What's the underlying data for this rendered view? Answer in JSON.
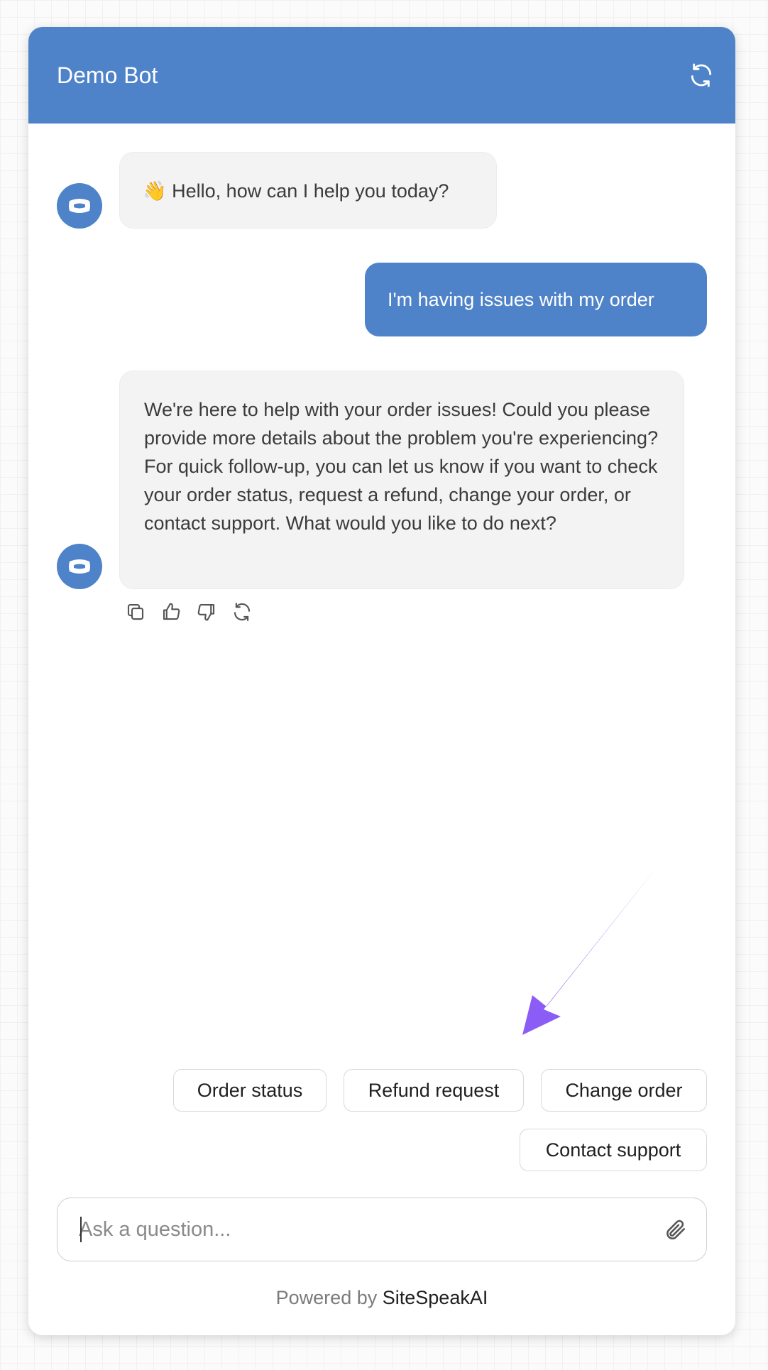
{
  "header": {
    "title": "Demo Bot",
    "refresh_icon": "refresh-icon"
  },
  "messages": [
    {
      "role": "bot",
      "emoji": "👋",
      "text": "Hello, how can I help you today?"
    },
    {
      "role": "user",
      "text": "I'm having issues with my order"
    },
    {
      "role": "bot",
      "text": "We're here to help with your order issues! Could you please provide more details about the problem you're experiencing? For quick follow-up, you can let us know if you want to check your order status, request a refund, change your order, or contact support. What would you like to do next?"
    }
  ],
  "message_actions": [
    "copy-icon",
    "thumbs-up-icon",
    "thumbs-down-icon",
    "regenerate-icon"
  ],
  "suggestions": [
    "Order status",
    "Refund request",
    "Change order",
    "Contact support"
  ],
  "input": {
    "placeholder": "Ask a question...",
    "value": "",
    "attach_icon": "paperclip-icon"
  },
  "footer": {
    "prefix": "Powered by",
    "brand": "SiteSpeakAI"
  },
  "colors": {
    "accent": "#4f83c9",
    "bot_bubble": "#f3f3f3",
    "annotation_arrow": "#8b5cf6"
  }
}
